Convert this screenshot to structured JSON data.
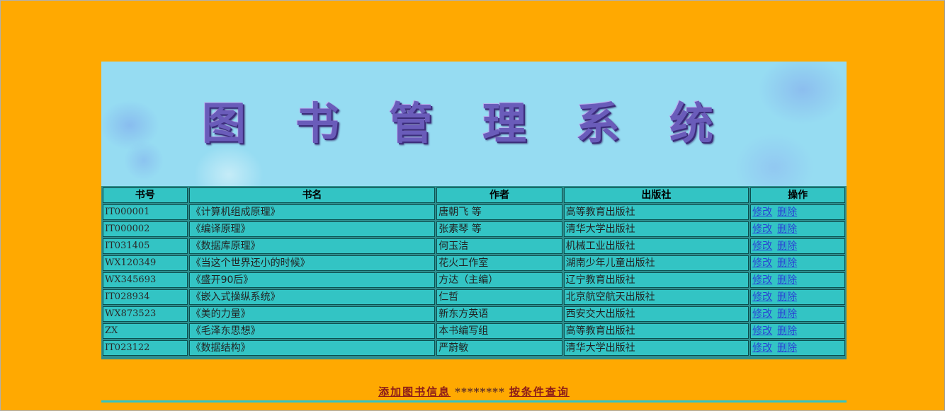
{
  "banner": {
    "title": "图书管理系统"
  },
  "table": {
    "headers": [
      "书号",
      "书名",
      "作者",
      "出版社",
      "操作"
    ],
    "rows": [
      {
        "code": "IT000001",
        "title": "《计算机组成原理》",
        "author": "唐朝飞 等",
        "publisher": "高等教育出版社",
        "edit": "修改",
        "delete": "删除"
      },
      {
        "code": "IT000002",
        "title": "《编译原理》",
        "author": "张素琴 等",
        "publisher": "清华大学出版社",
        "edit": "修改",
        "delete": "删除"
      },
      {
        "code": "IT031405",
        "title": "《数据库原理》",
        "author": "何玉洁",
        "publisher": "机械工业出版社",
        "edit": "修改",
        "delete": "删除"
      },
      {
        "code": "WX120349",
        "title": "《当这个世界还小的时候》",
        "author": "花火工作室",
        "publisher": "湖南少年儿童出版社",
        "edit": "修改",
        "delete": "删除"
      },
      {
        "code": "WX345693",
        "title": "《盛开90后》",
        "author": "方达（主编）",
        "publisher": "辽宁教育出版社",
        "edit": "修改",
        "delete": "删除"
      },
      {
        "code": "IT028934",
        "title": "《嵌入式操纵系统》",
        "author": "仁哲",
        "publisher": "北京航空航天出版社",
        "edit": "修改",
        "delete": "删除"
      },
      {
        "code": "WX873523",
        "title": "《美的力量》",
        "author": "新东方英语",
        "publisher": "西安交大出版社",
        "edit": "修改",
        "delete": "删除"
      },
      {
        "code": "ZX",
        "title": "《毛泽东思想》",
        "author": "本书编写组",
        "publisher": "高等教育出版社",
        "edit": "修改",
        "delete": "删除"
      },
      {
        "code": "IT023122",
        "title": "《数据结构》",
        "author": "严蔚敏",
        "publisher": "清华大学出版社",
        "edit": "修改",
        "delete": "删除"
      }
    ]
  },
  "footer": {
    "add_link": "添加图书信息",
    "separator": "********",
    "query_link": "按条件查询"
  },
  "colors": {
    "page_bg": "#FFA901",
    "banner_bg": "#96DCF2",
    "cell_bg": "#33C4C4",
    "link": "#2a44d4",
    "footer_link": "#8b1a1a"
  }
}
